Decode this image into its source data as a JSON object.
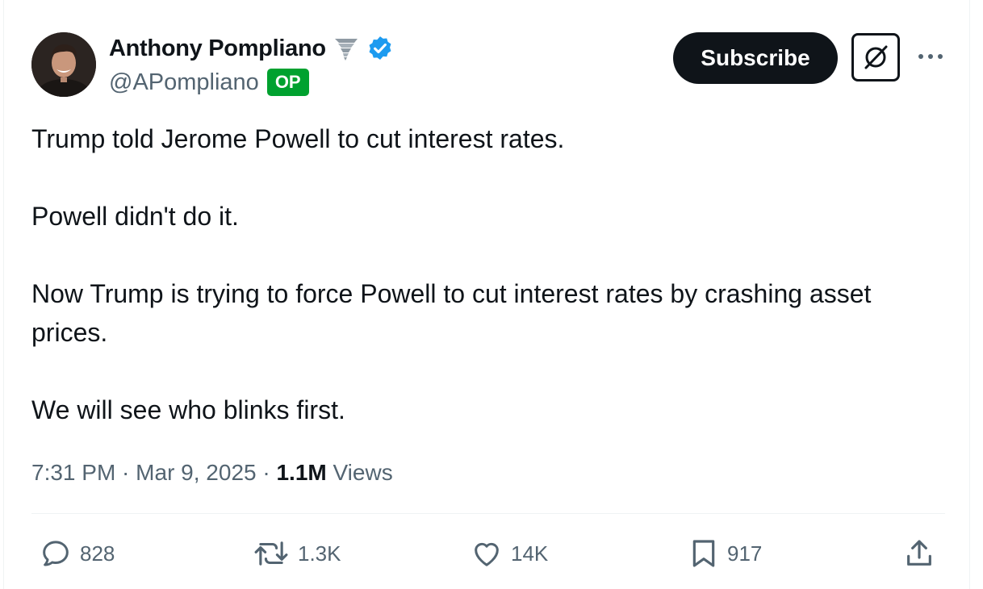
{
  "author": {
    "display_name": "Anthony Pompliano",
    "handle": "@APompliano",
    "op_badge": "OP",
    "name_emoji_icon": "tornado-icon",
    "verified_icon": "verified-badge-icon"
  },
  "header_actions": {
    "subscribe_label": "Subscribe",
    "grok_icon": "grok-icon",
    "more_icon": "more-horizontal-icon"
  },
  "tweet": {
    "paragraphs": [
      "Trump told Jerome Powell to cut interest rates.",
      "Powell didn't do it.",
      "Now Trump is trying to force Powell to cut interest rates by crashing asset prices.",
      "We will see who blinks first."
    ]
  },
  "meta": {
    "time": "7:31 PM",
    "separator": " · ",
    "date": "Mar 9, 2025",
    "views_count": "1.1M",
    "views_label": " Views"
  },
  "actions": {
    "replies": "828",
    "reposts": "1.3K",
    "likes": "14K",
    "bookmarks": "917"
  },
  "colors": {
    "text_primary": "#0f1419",
    "text_secondary": "#536471",
    "verified_blue": "#1d9bf0",
    "op_green": "#00a12f",
    "divider": "#eff3f4"
  }
}
